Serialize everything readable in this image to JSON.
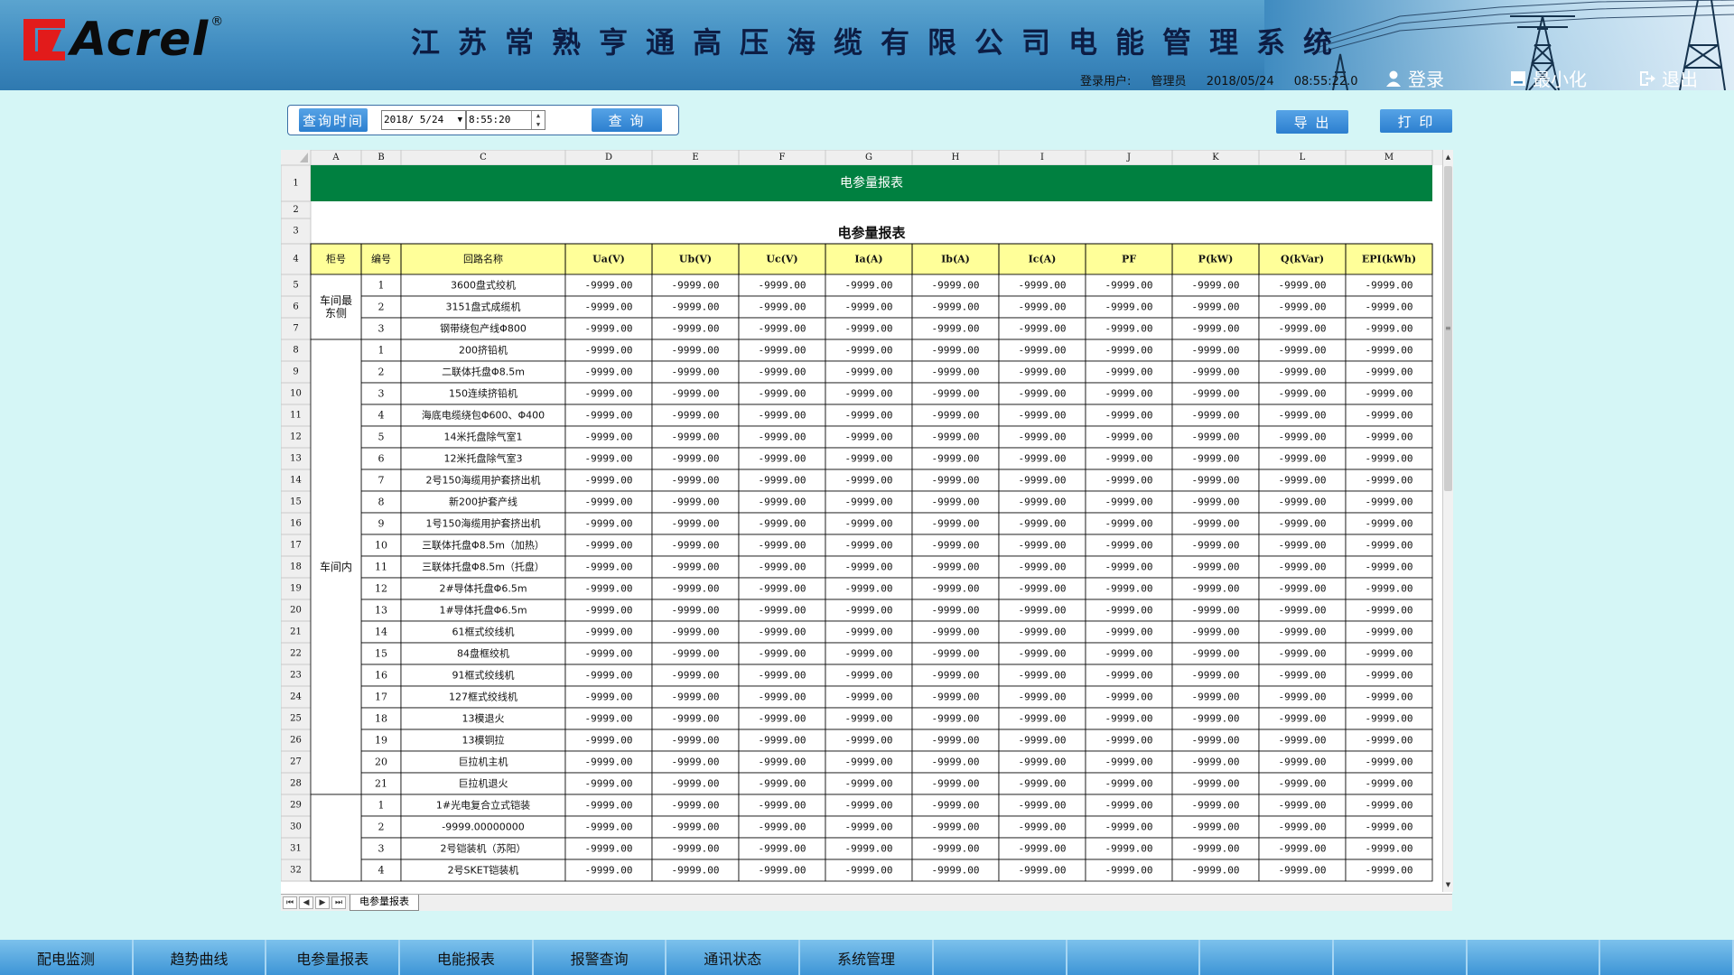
{
  "header": {
    "logo_text": "Acrel",
    "logo_reg": "®",
    "title": "江苏常熟亨通高压海缆有限公司电能管理系统",
    "user_label": "登录用户:",
    "user_name": "管理员",
    "date": "2018/05/24",
    "time": "08:55:22.0",
    "login_label": "登录",
    "minimize_label": "最小化",
    "exit_label": "退出"
  },
  "query": {
    "query_time_label": "查询时间",
    "date_value": "2018/ 5/24",
    "time_value": "8:55:20",
    "query_button": "查 询",
    "export_button": "导 出",
    "print_button": "打 印"
  },
  "sheet": {
    "col_letters": [
      "A",
      "B",
      "C",
      "D",
      "E",
      "F",
      "G",
      "H",
      "I",
      "J",
      "K",
      "L",
      "M"
    ],
    "row_numbers": [
      "1",
      "2",
      "3",
      "4",
      "5",
      "6",
      "7",
      "8",
      "9",
      "10",
      "11",
      "12",
      "13",
      "14",
      "15",
      "16",
      "17",
      "18",
      "19",
      "20",
      "21",
      "22",
      "23",
      "24",
      "25",
      "26",
      "27",
      "28",
      "29",
      "30",
      "31",
      "32"
    ],
    "banner_title": "电参量报表",
    "report_title": "电参量报表",
    "headers": [
      "柜号",
      "编号",
      "回路名称",
      "Ua(V)",
      "Ub(V)",
      "Uc(V)",
      "Ia(A)",
      "Ib(A)",
      "Ic(A)",
      "PF",
      "P(kW)",
      "Q(kVar)",
      "EPI(kWh)"
    ],
    "groups": [
      {
        "label": "车间最东侧",
        "start": 0,
        "span": 3
      },
      {
        "label": "车间内",
        "start": 3,
        "span": 21
      },
      {
        "label": "",
        "start": 24,
        "span": 4
      }
    ],
    "rows": [
      {
        "no": "1",
        "name": "3600盘式绞机",
        "vals": [
          "-9999.00",
          "-9999.00",
          "-9999.00",
          "-9999.00",
          "-9999.00",
          "-9999.00",
          "-9999.00",
          "-9999.00",
          "-9999.00",
          "-9999.00"
        ]
      },
      {
        "no": "2",
        "name": "3151盘式成缆机",
        "vals": [
          "-9999.00",
          "-9999.00",
          "-9999.00",
          "-9999.00",
          "-9999.00",
          "-9999.00",
          "-9999.00",
          "-9999.00",
          "-9999.00",
          "-9999.00"
        ]
      },
      {
        "no": "3",
        "name": "钢带绕包产线Φ800",
        "vals": [
          "-9999.00",
          "-9999.00",
          "-9999.00",
          "-9999.00",
          "-9999.00",
          "-9999.00",
          "-9999.00",
          "-9999.00",
          "-9999.00",
          "-9999.00"
        ]
      },
      {
        "no": "1",
        "name": "200挤铅机",
        "vals": [
          "-9999.00",
          "-9999.00",
          "-9999.00",
          "-9999.00",
          "-9999.00",
          "-9999.00",
          "-9999.00",
          "-9999.00",
          "-9999.00",
          "-9999.00"
        ]
      },
      {
        "no": "2",
        "name": "二联体托盘Φ8.5m",
        "vals": [
          "-9999.00",
          "-9999.00",
          "-9999.00",
          "-9999.00",
          "-9999.00",
          "-9999.00",
          "-9999.00",
          "-9999.00",
          "-9999.00",
          "-9999.00"
        ]
      },
      {
        "no": "3",
        "name": "150连续挤铅机",
        "vals": [
          "-9999.00",
          "-9999.00",
          "-9999.00",
          "-9999.00",
          "-9999.00",
          "-9999.00",
          "-9999.00",
          "-9999.00",
          "-9999.00",
          "-9999.00"
        ]
      },
      {
        "no": "4",
        "name": "海底电缆绕包Φ600、Φ400",
        "vals": [
          "-9999.00",
          "-9999.00",
          "-9999.00",
          "-9999.00",
          "-9999.00",
          "-9999.00",
          "-9999.00",
          "-9999.00",
          "-9999.00",
          "-9999.00"
        ]
      },
      {
        "no": "5",
        "name": "14米托盘除气室1",
        "vals": [
          "-9999.00",
          "-9999.00",
          "-9999.00",
          "-9999.00",
          "-9999.00",
          "-9999.00",
          "-9999.00",
          "-9999.00",
          "-9999.00",
          "-9999.00"
        ]
      },
      {
        "no": "6",
        "name": "12米托盘除气室3",
        "vals": [
          "-9999.00",
          "-9999.00",
          "-9999.00",
          "-9999.00",
          "-9999.00",
          "-9999.00",
          "-9999.00",
          "-9999.00",
          "-9999.00",
          "-9999.00"
        ]
      },
      {
        "no": "7",
        "name": "2号150海缆用护套挤出机",
        "vals": [
          "-9999.00",
          "-9999.00",
          "-9999.00",
          "-9999.00",
          "-9999.00",
          "-9999.00",
          "-9999.00",
          "-9999.00",
          "-9999.00",
          "-9999.00"
        ]
      },
      {
        "no": "8",
        "name": "新200护套产线",
        "vals": [
          "-9999.00",
          "-9999.00",
          "-9999.00",
          "-9999.00",
          "-9999.00",
          "-9999.00",
          "-9999.00",
          "-9999.00",
          "-9999.00",
          "-9999.00"
        ]
      },
      {
        "no": "9",
        "name": "1号150海缆用护套挤出机",
        "vals": [
          "-9999.00",
          "-9999.00",
          "-9999.00",
          "-9999.00",
          "-9999.00",
          "-9999.00",
          "-9999.00",
          "-9999.00",
          "-9999.00",
          "-9999.00"
        ]
      },
      {
        "no": "10",
        "name": "三联体托盘Φ8.5m（加热）",
        "vals": [
          "-9999.00",
          "-9999.00",
          "-9999.00",
          "-9999.00",
          "-9999.00",
          "-9999.00",
          "-9999.00",
          "-9999.00",
          "-9999.00",
          "-9999.00"
        ]
      },
      {
        "no": "11",
        "name": "三联体托盘Φ8.5m（托盘）",
        "vals": [
          "-9999.00",
          "-9999.00",
          "-9999.00",
          "-9999.00",
          "-9999.00",
          "-9999.00",
          "-9999.00",
          "-9999.00",
          "-9999.00",
          "-9999.00"
        ]
      },
      {
        "no": "12",
        "name": "2#导体托盘Φ6.5m",
        "vals": [
          "-9999.00",
          "-9999.00",
          "-9999.00",
          "-9999.00",
          "-9999.00",
          "-9999.00",
          "-9999.00",
          "-9999.00",
          "-9999.00",
          "-9999.00"
        ]
      },
      {
        "no": "13",
        "name": "1#导体托盘Φ6.5m",
        "vals": [
          "-9999.00",
          "-9999.00",
          "-9999.00",
          "-9999.00",
          "-9999.00",
          "-9999.00",
          "-9999.00",
          "-9999.00",
          "-9999.00",
          "-9999.00"
        ]
      },
      {
        "no": "14",
        "name": "61框式绞线机",
        "vals": [
          "-9999.00",
          "-9999.00",
          "-9999.00",
          "-9999.00",
          "-9999.00",
          "-9999.00",
          "-9999.00",
          "-9999.00",
          "-9999.00",
          "-9999.00"
        ]
      },
      {
        "no": "15",
        "name": "84盘框绞机",
        "vals": [
          "-9999.00",
          "-9999.00",
          "-9999.00",
          "-9999.00",
          "-9999.00",
          "-9999.00",
          "-9999.00",
          "-9999.00",
          "-9999.00",
          "-9999.00"
        ]
      },
      {
        "no": "16",
        "name": "91框式绞线机",
        "vals": [
          "-9999.00",
          "-9999.00",
          "-9999.00",
          "-9999.00",
          "-9999.00",
          "-9999.00",
          "-9999.00",
          "-9999.00",
          "-9999.00",
          "-9999.00"
        ]
      },
      {
        "no": "17",
        "name": "127框式绞线机",
        "vals": [
          "-9999.00",
          "-9999.00",
          "-9999.00",
          "-9999.00",
          "-9999.00",
          "-9999.00",
          "-9999.00",
          "-9999.00",
          "-9999.00",
          "-9999.00"
        ]
      },
      {
        "no": "18",
        "name": "13模退火",
        "vals": [
          "-9999.00",
          "-9999.00",
          "-9999.00",
          "-9999.00",
          "-9999.00",
          "-9999.00",
          "-9999.00",
          "-9999.00",
          "-9999.00",
          "-9999.00"
        ]
      },
      {
        "no": "19",
        "name": "13模铜拉",
        "vals": [
          "-9999.00",
          "-9999.00",
          "-9999.00",
          "-9999.00",
          "-9999.00",
          "-9999.00",
          "-9999.00",
          "-9999.00",
          "-9999.00",
          "-9999.00"
        ]
      },
      {
        "no": "20",
        "name": "巨拉机主机",
        "vals": [
          "-9999.00",
          "-9999.00",
          "-9999.00",
          "-9999.00",
          "-9999.00",
          "-9999.00",
          "-9999.00",
          "-9999.00",
          "-9999.00",
          "-9999.00"
        ]
      },
      {
        "no": "21",
        "name": "巨拉机退火",
        "vals": [
          "-9999.00",
          "-9999.00",
          "-9999.00",
          "-9999.00",
          "-9999.00",
          "-9999.00",
          "-9999.00",
          "-9999.00",
          "-9999.00",
          "-9999.00"
        ]
      },
      {
        "no": "1",
        "name": "1#光电复合立式铠装",
        "vals": [
          "-9999.00",
          "-9999.00",
          "-9999.00",
          "-9999.00",
          "-9999.00",
          "-9999.00",
          "-9999.00",
          "-9999.00",
          "-9999.00",
          "-9999.00"
        ]
      },
      {
        "no": "2",
        "name": "-9999.00000000",
        "vals": [
          "-9999.00",
          "-9999.00",
          "-9999.00",
          "-9999.00",
          "-9999.00",
          "-9999.00",
          "-9999.00",
          "-9999.00",
          "-9999.00",
          "-9999.00"
        ]
      },
      {
        "no": "3",
        "name": "2号铠装机（苏阳）",
        "vals": [
          "-9999.00",
          "-9999.00",
          "-9999.00",
          "-9999.00",
          "-9999.00",
          "-9999.00",
          "-9999.00",
          "-9999.00",
          "-9999.00",
          "-9999.00"
        ]
      },
      {
        "no": "4",
        "name": "2号SKET铠装机",
        "vals": [
          "-9999.00",
          "-9999.00",
          "-9999.00",
          "-9999.00",
          "-9999.00",
          "-9999.00",
          "-9999.00",
          "-9999.00",
          "-9999.00",
          "-9999.00"
        ]
      }
    ],
    "tab_label": "电参量报表"
  },
  "bottom_nav": [
    "配电监测",
    "趋势曲线",
    "电参量报表",
    "电能报表",
    "报警查询",
    "通讯状态",
    "系统管理"
  ],
  "colors": {
    "banner_green": "#008040",
    "header_yellow": "#ffff99",
    "page_bg": "#d5f6f6",
    "nav_blue": "#3d95d6"
  }
}
